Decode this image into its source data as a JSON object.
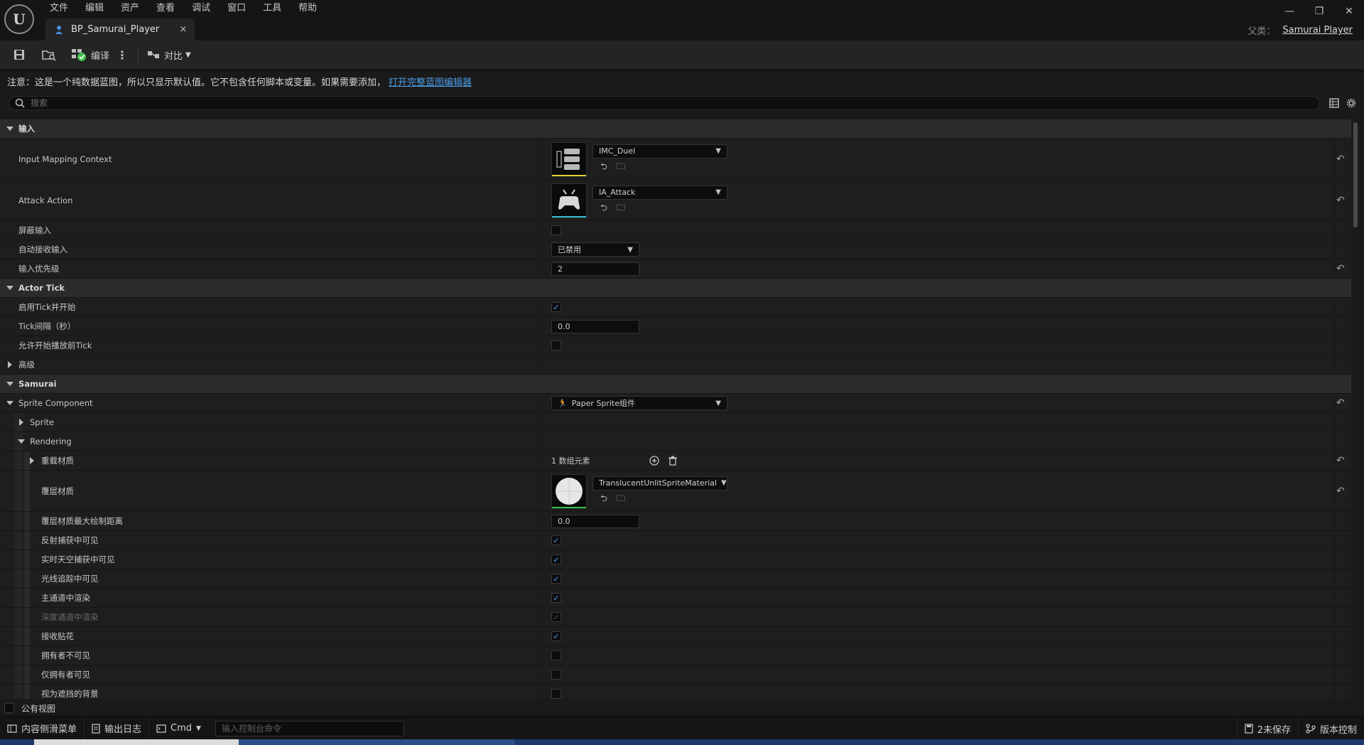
{
  "menu": [
    "文件",
    "编辑",
    "资产",
    "查看",
    "调试",
    "窗口",
    "工具",
    "帮助"
  ],
  "tab": {
    "title": "BP_Samurai_Player",
    "close": "×"
  },
  "window_controls": [
    "—",
    "❐",
    "✕"
  ],
  "parent_class": {
    "label": "父类：",
    "value": "Samurai Player"
  },
  "toolbar": {
    "compile_label": "编译",
    "diff_label": "对比"
  },
  "notice": {
    "text": "注意：这是一个纯数据蓝图，所以只显示默认值。它不包含任何脚本或变量。如果需要添加，",
    "link": "打开完整蓝图编辑器"
  },
  "search": {
    "placeholder": "搜索"
  },
  "categories": {
    "input": "输入",
    "actor_tick": "Actor Tick",
    "advanced": "高级",
    "samurai": "Samurai"
  },
  "props": {
    "input_mapping_context": {
      "label": "Input Mapping Context",
      "value": "IMC_Duel"
    },
    "attack_action": {
      "label": "Attack Action",
      "value": "IA_Attack"
    },
    "block_input": {
      "label": "屏蔽输入",
      "checked": false
    },
    "auto_receive_input": {
      "label": "自动接收输入",
      "value": "已禁用"
    },
    "input_priority": {
      "label": "输入优先级",
      "value": "2"
    },
    "start_with_tick": {
      "label": "启用Tick并开始",
      "checked": true
    },
    "tick_interval": {
      "label": "Tick间隔（秒）",
      "value": "0.0"
    },
    "tick_before_begin": {
      "label": "允许开始播放前Tick",
      "checked": false
    },
    "sprite_component": {
      "label": "Sprite Component",
      "value": "Paper Sprite组件"
    },
    "sprite": {
      "label": "Sprite"
    },
    "rendering": {
      "label": "Rendering"
    },
    "override_materials": {
      "label": "重载材质",
      "value": "1 数组元素"
    },
    "overlay_material": {
      "label": "覆层材质",
      "value": "TranslucentUnlitSpriteMaterial"
    },
    "overlay_max_draw": {
      "label": "覆层材质最大绘制距离",
      "value": "0.0"
    },
    "visible_reflection": {
      "label": "反射捕获中可见",
      "checked": true
    },
    "visible_sky": {
      "label": "实时天空捕获中可见",
      "checked": true
    },
    "visible_raytracing": {
      "label": "光线追踪中可见",
      "checked": true
    },
    "render_main_pass": {
      "label": "主通道中渲染",
      "checked": true
    },
    "render_depth_pass": {
      "label": "深度通道中渲染",
      "checked": true
    },
    "receives_decals": {
      "label": "接收贴花",
      "checked": true
    },
    "owner_no_see": {
      "label": "拥有者不可见",
      "checked": false
    },
    "only_owner_see": {
      "label": "仅拥有者可见",
      "checked": false
    },
    "treat_as_background": {
      "label": "视为遮挡的背景",
      "checked": false
    }
  },
  "public_view": {
    "label": "公有视图"
  },
  "statusbar": {
    "content_drawer": "内容侧滑菜单",
    "output_log": "输出日志",
    "cmd": "Cmd",
    "console_placeholder": "输入控制台命令",
    "unsaved": "2未保存",
    "source_control": "版本控制"
  },
  "colors": {
    "accent_blue": "#4a9fff",
    "link_blue": "#4d9fe8",
    "imc_underline": "#e8d23a",
    "ia_underline": "#3ac0d8",
    "material_underline": "#3dbf4a"
  }
}
